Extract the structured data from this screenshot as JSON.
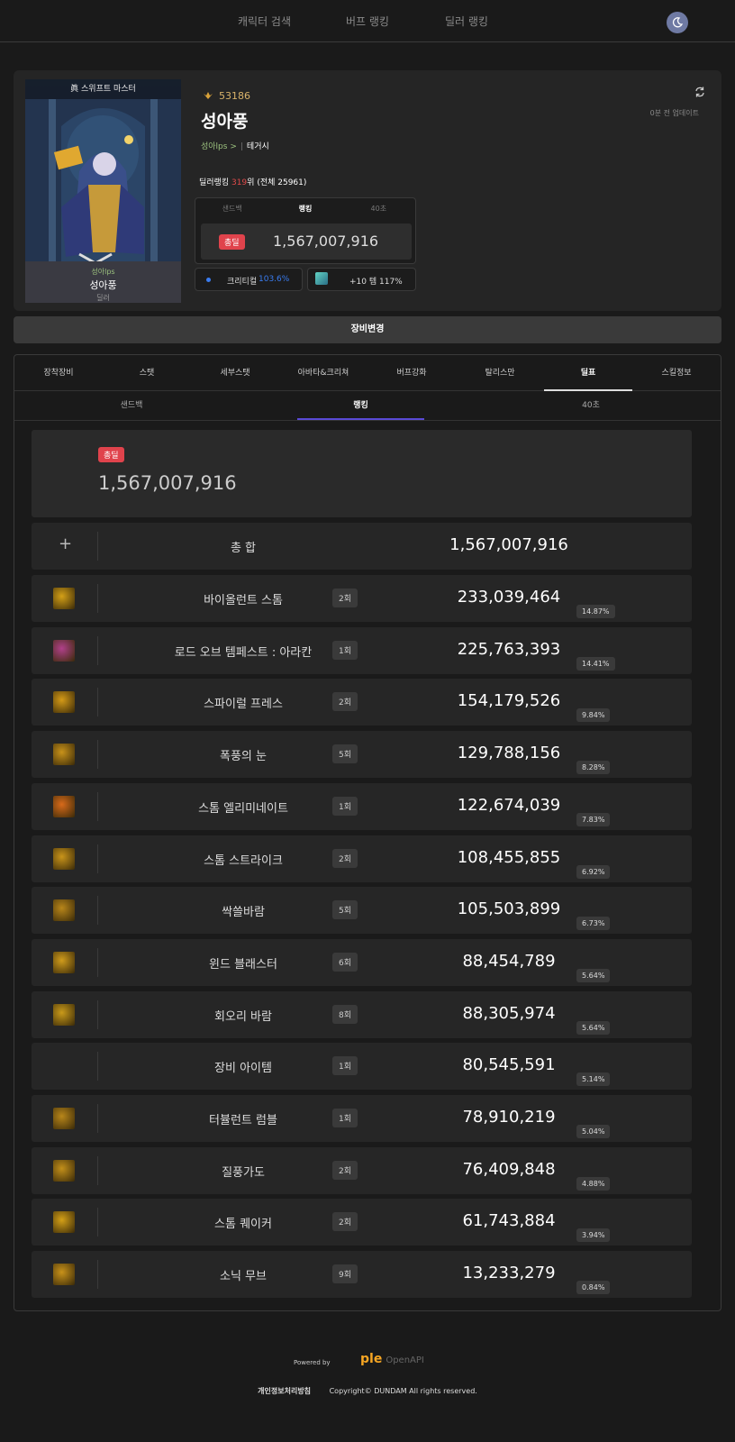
{
  "nav": {
    "items": [
      "캐릭터 검색",
      "버프 랭킹",
      "딜러 랭킹"
    ]
  },
  "profile": {
    "portrait_title": "眞 스위프트 마스터",
    "adventure": "성아lps",
    "name": "성아풍",
    "role": "딜러",
    "fame": "53186",
    "adventure_link": "성아lps >",
    "guild": "테거시",
    "updated": "0분 전 업데이트",
    "rank_prefix": "딜러랭킹 ",
    "rank_value": "319",
    "rank_suffix": "위 (전체 25961)"
  },
  "damage_box": {
    "tabs": [
      "샌드백",
      "랭킹",
      "40초"
    ],
    "active_tab": "랭킹",
    "total_tag": "총딜",
    "total_value": "1,567,007,916"
  },
  "buffs": {
    "crit_label": "크리티컬",
    "crit_value": "103.6%",
    "rune_text": "+10 템 117%"
  },
  "equip_button": "장비변경",
  "main_tabs": [
    "장착장비",
    "스탯",
    "세부스탯",
    "아바타&크리쳐",
    "버프강화",
    "탈리스만",
    "딜표",
    "스킬정보"
  ],
  "active_main_tab": "딜표",
  "sub_tabs": [
    "샌드백",
    "랭킹",
    "40초"
  ],
  "active_sub_tab": "랭킹",
  "summary": {
    "tag": "총딜",
    "value": "1,567,007,916",
    "total_label": "총 합",
    "total_value": "1,567,007,916"
  },
  "skills": [
    {
      "name": "바이올런트 스톰",
      "count": "2회",
      "damage": "233,039,464",
      "pct": "14.87%",
      "icon": "violent-storm-icon",
      "color": "#d4a017"
    },
    {
      "name": "로드 오브 템페스트 : 아라칸",
      "count": "1회",
      "damage": "225,763,393",
      "pct": "14.41%",
      "icon": "lord-of-tempest-icon",
      "color": "#b0408a"
    },
    {
      "name": "스파이럴 프레스",
      "count": "2회",
      "damage": "154,179,526",
      "pct": "9.84%",
      "icon": "spiral-press-icon",
      "color": "#d49a17"
    },
    {
      "name": "폭풍의 눈",
      "count": "5회",
      "damage": "129,788,156",
      "pct": "8.28%",
      "icon": "eye-of-storm-icon",
      "color": "#c8921a"
    },
    {
      "name": "스톰 엘리미네이트",
      "count": "1회",
      "damage": "122,674,039",
      "pct": "7.83%",
      "icon": "storm-eliminate-icon",
      "color": "#d86a1a"
    },
    {
      "name": "스톰 스트라이크",
      "count": "2회",
      "damage": "108,455,855",
      "pct": "6.92%",
      "icon": "storm-strike-icon",
      "color": "#c9941a"
    },
    {
      "name": "싹쓸바람",
      "count": "5회",
      "damage": "105,503,899",
      "pct": "6.73%",
      "icon": "sweeping-wind-icon",
      "color": "#b8861a"
    },
    {
      "name": "윈드 블래스터",
      "count": "6회",
      "damage": "88,454,789",
      "pct": "5.64%",
      "icon": "wind-blaster-icon",
      "color": "#d09c1c"
    },
    {
      "name": "회오리 바람",
      "count": "8회",
      "damage": "88,305,974",
      "pct": "5.64%",
      "icon": "whirlwind-icon",
      "color": "#c99a1a"
    },
    {
      "name": "장비 아이템",
      "count": "1회",
      "damage": "80,545,591",
      "pct": "5.14%",
      "icon": "",
      "color": ""
    },
    {
      "name": "터뷸런트 럼블",
      "count": "1회",
      "damage": "78,910,219",
      "pct": "5.04%",
      "icon": "turbulent-rumble-icon",
      "color": "#b8861a"
    },
    {
      "name": "질풍가도",
      "count": "2회",
      "damage": "76,409,848",
      "pct": "4.88%",
      "icon": "gale-road-icon",
      "color": "#c28f1a"
    },
    {
      "name": "스톰 퀘이커",
      "count": "2회",
      "damage": "61,743,884",
      "pct": "3.94%",
      "icon": "storm-quaker-icon",
      "color": "#d4a017"
    },
    {
      "name": "소닉 무브",
      "count": "9회",
      "damage": "13,233,279",
      "pct": "0.84%",
      "icon": "sonic-move-icon",
      "color": "#c8921a"
    }
  ],
  "footer": {
    "powered_by": "Powered by",
    "logo": "ple",
    "logo_sub": "OpenAPI",
    "privacy": "개인정보처리방침",
    "copyright": "Copyright© DUNDAM All rights reserved."
  }
}
